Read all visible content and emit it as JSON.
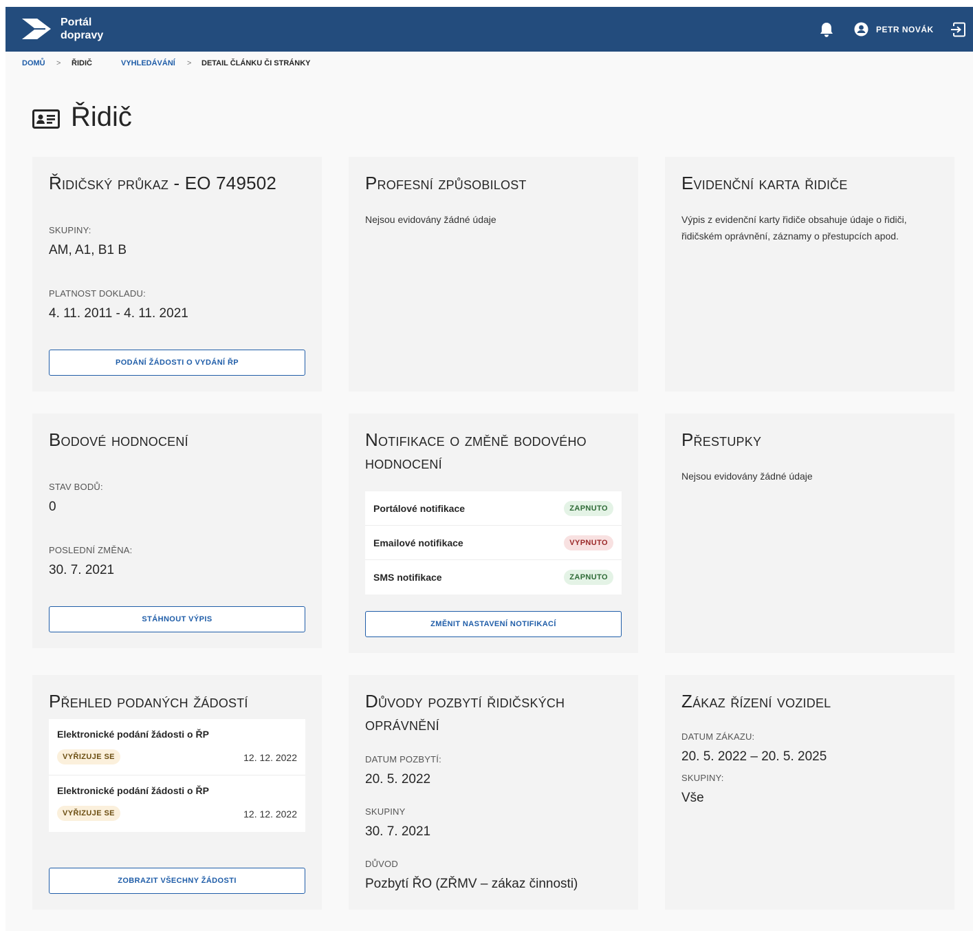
{
  "header": {
    "brand_line1": "Portál",
    "brand_line2": "dopravy",
    "user_name": "PETR NOVÁK"
  },
  "breadcrumb": [
    "DOMŮ",
    "ŘIDIČ",
    "VYHLEDÁVÁNÍ",
    "DETAIL ČLÁNKU ČI STRÁNKY"
  ],
  "page": {
    "title": "Řidič"
  },
  "cards": {
    "license": {
      "title": "Řidičský průkaz - EO 749502",
      "groups_label": "SKUPINY:",
      "groups_value": "AM, A1, B1 B",
      "validity_label": "PLATNOST DOKLADU:",
      "validity_value": "4. 11. 2011 - 4. 11. 2021",
      "button": "PODÁNÍ ŽÁDOSTI O VYDÁNÍ ŘP"
    },
    "professional": {
      "title": "Profesní způsobilost",
      "text": "Nejsou evidovány žádné údaje"
    },
    "record_card": {
      "title": "Evidenční karta řidiče",
      "text": "Výpis z evidenční karty řidiče obsahuje údaje o řidiči, řidičském oprávnění, záznamy o přestupcích apod."
    },
    "points": {
      "title": "Bodové hodnocení",
      "state_label": "STAV BODŮ:",
      "state_value": "0",
      "last_change_label": "POSLEDNÍ ZMĚNA:",
      "last_change_value": "30. 7. 2021",
      "button": "STÁHNOUT VÝPIS"
    },
    "notifications": {
      "title": "Notifikace o změně bodového hodnocení",
      "items": [
        {
          "label": "Portálové notifikace",
          "status": "ZAPNUTO"
        },
        {
          "label": "Emailové notifikace",
          "status": "VYPNUTO"
        },
        {
          "label": "SMS notifikace",
          "status": "ZAPNUTO"
        }
      ],
      "button": "ZMĚNIT NASTAVENÍ NOTIFIKACÍ"
    },
    "offenses": {
      "title": "Přestupky",
      "text": "Nejsou evidovány žádné údaje"
    },
    "requests": {
      "title": "Přehled podaných žádostí",
      "items": [
        {
          "title": "Elektronické podání žádosti o ŘP",
          "status": "VYŘIZUJE SE",
          "date": "12. 12. 2022"
        },
        {
          "title": "Elektronické podání žádosti o ŘP",
          "status": "VYŘIZUJE SE",
          "date": "12. 12. 2022"
        }
      ],
      "button": "ZOBRAZIT VŠECHNY ŽÁDOSTI"
    },
    "revocation": {
      "title": "Důvody pozbytí řidičských oprávnění",
      "date_label": "DATUM POZBYTÍ:",
      "date_value": "20. 5. 2022",
      "groups_label": "SKUPINY",
      "groups_value": "30. 7. 2021",
      "reason_label": "DŮVOD",
      "reason_value": "Pozbytí ŘO (ZŘMV – zákaz činnosti)"
    },
    "ban": {
      "title": "Zákaz řízení vozidel",
      "date_label": "DATUM ZÁKAZU:",
      "date_value": "20. 5. 2022 – 20. 5. 2025",
      "groups_label": "SKUPINY:",
      "groups_value": "Vše"
    }
  },
  "colors": {
    "header_bg": "#234c7d",
    "link": "#1f5da8",
    "status_on": "#e4f3e6",
    "status_off": "#f8e1e1",
    "status_pending": "#fbf0dc"
  },
  "icons": {
    "logo": "portal-logo-icon",
    "bell": "bell-icon",
    "user": "user-avatar-icon",
    "logout": "logout-icon",
    "title": "id-card-icon"
  }
}
